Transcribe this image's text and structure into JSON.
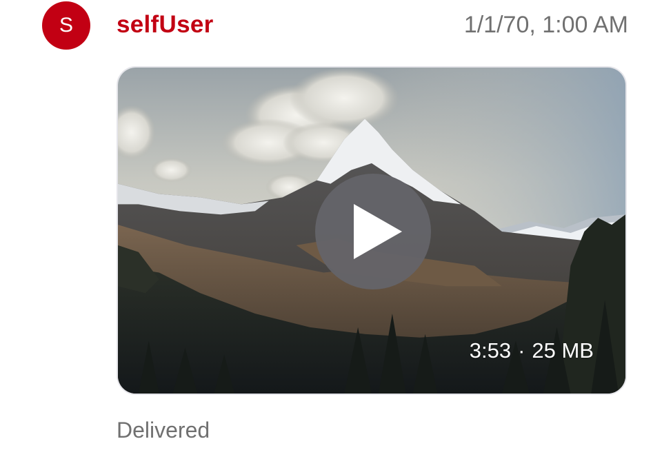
{
  "message": {
    "avatar_initial": "S",
    "sender_name": "selfUser",
    "timestamp": "1/1/70, 1:00 AM",
    "video": {
      "duration": "3:53",
      "separator": "·",
      "size": "25 MB"
    },
    "status": "Delivered"
  },
  "colors": {
    "accent": "#c20013",
    "secondary_text": "#707070",
    "play_button": "#646469"
  },
  "icons": {
    "play": "play-icon"
  }
}
